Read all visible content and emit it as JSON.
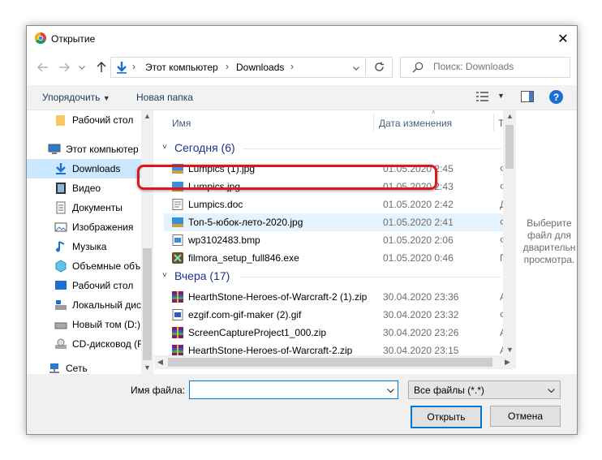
{
  "window": {
    "title": "Открытие",
    "close_glyph": "✕"
  },
  "nav": {
    "back_icon": "arrow-left-icon",
    "forward_icon": "arrow-right-icon",
    "recent_icon": "chevron-down-icon",
    "up_icon": "arrow-up-icon",
    "path": [
      "Этот компьютер",
      "Downloads"
    ],
    "refresh_icon": "refresh-icon"
  },
  "search": {
    "placeholder": "Поиск: Downloads"
  },
  "toolbar": {
    "organize_label": "Упорядочить",
    "new_folder_label": "Новая папка",
    "help_glyph": "?"
  },
  "sidebar": {
    "items": [
      {
        "label": "Рабочий стол",
        "icon": "folder-icon"
      },
      {
        "label": "Этот компьютер",
        "icon": "computer-icon"
      },
      {
        "label": "Downloads",
        "icon": "download-icon",
        "selected": true
      },
      {
        "label": "Видео",
        "icon": "video-icon"
      },
      {
        "label": "Документы",
        "icon": "documents-icon"
      },
      {
        "label": "Изображения",
        "icon": "pictures-icon"
      },
      {
        "label": "Музыка",
        "icon": "music-icon"
      },
      {
        "label": "Объемные объ",
        "icon": "3d-objects-icon"
      },
      {
        "label": "Рабочий стол",
        "icon": "desktop-icon"
      },
      {
        "label": "Локальный дис",
        "icon": "local-disk-icon"
      },
      {
        "label": "Новый том (D:)",
        "icon": "drive-icon"
      },
      {
        "label": "CD-дисковод (F",
        "icon": "cd-drive-icon"
      },
      {
        "label": "Сеть",
        "icon": "network-icon"
      }
    ]
  },
  "columns": {
    "name": "Имя",
    "date": "Дата изменения",
    "type": "Т"
  },
  "groups": {
    "today": "Сегодня (6)",
    "yesterday": "Вчера (17)"
  },
  "files_today": [
    {
      "name": "Lumpics (1).jpg",
      "date": "01.05.2020 2:45",
      "type": "Ф",
      "icon": "image-file-icon"
    },
    {
      "name": "Lumpics.jpg",
      "date": "01.05.2020 2:43",
      "type": "Ф",
      "icon": "image-file-icon"
    },
    {
      "name": "Lumpics.doc",
      "date": "01.05.2020 2:42",
      "type": "Д",
      "icon": "document-file-icon"
    },
    {
      "name": "Топ-5-юбок-лето-2020.jpg",
      "date": "01.05.2020 2:41",
      "type": "Ф",
      "icon": "image-file-icon"
    },
    {
      "name": "wp3102483.bmp",
      "date": "01.05.2020 2:06",
      "type": "Ф",
      "icon": "bitmap-file-icon"
    },
    {
      "name": "filmora_setup_full846.exe",
      "date": "01.05.2020 0:46",
      "type": "П",
      "icon": "exe-file-icon"
    }
  ],
  "files_yesterday": [
    {
      "name": "HearthStone-Heroes-of-Warcraft-2 (1).zip",
      "date": "30.04.2020 23:36",
      "type": "А",
      "icon": "archive-file-icon"
    },
    {
      "name": "ezgif.com-gif-maker (2).gif",
      "date": "30.04.2020 23:32",
      "type": "Ф",
      "icon": "gif-file-icon"
    },
    {
      "name": "ScreenCaptureProject1_000.zip",
      "date": "30.04.2020 23:26",
      "type": "А",
      "icon": "archive-file-icon"
    },
    {
      "name": "HearthStone-Heroes-of-Warcraft-2.zip",
      "date": "30.04.2020 23:15",
      "type": "А",
      "icon": "archive-file-icon"
    }
  ],
  "preview": {
    "text_lines": [
      "Выберите",
      "файл для",
      "дварительн",
      "просмотра."
    ]
  },
  "footer": {
    "filename_label": "Имя файла:",
    "filename_value": "",
    "filter_value": "Все файлы (*.*)",
    "open_label": "Открыть",
    "cancel_label": "Отмена"
  },
  "colors": {
    "accent": "#0078d7",
    "selection": "#cce8ff",
    "hover": "#e5f3ff",
    "group_header": "#1e3287",
    "annotation_ring": "#e0161c"
  }
}
